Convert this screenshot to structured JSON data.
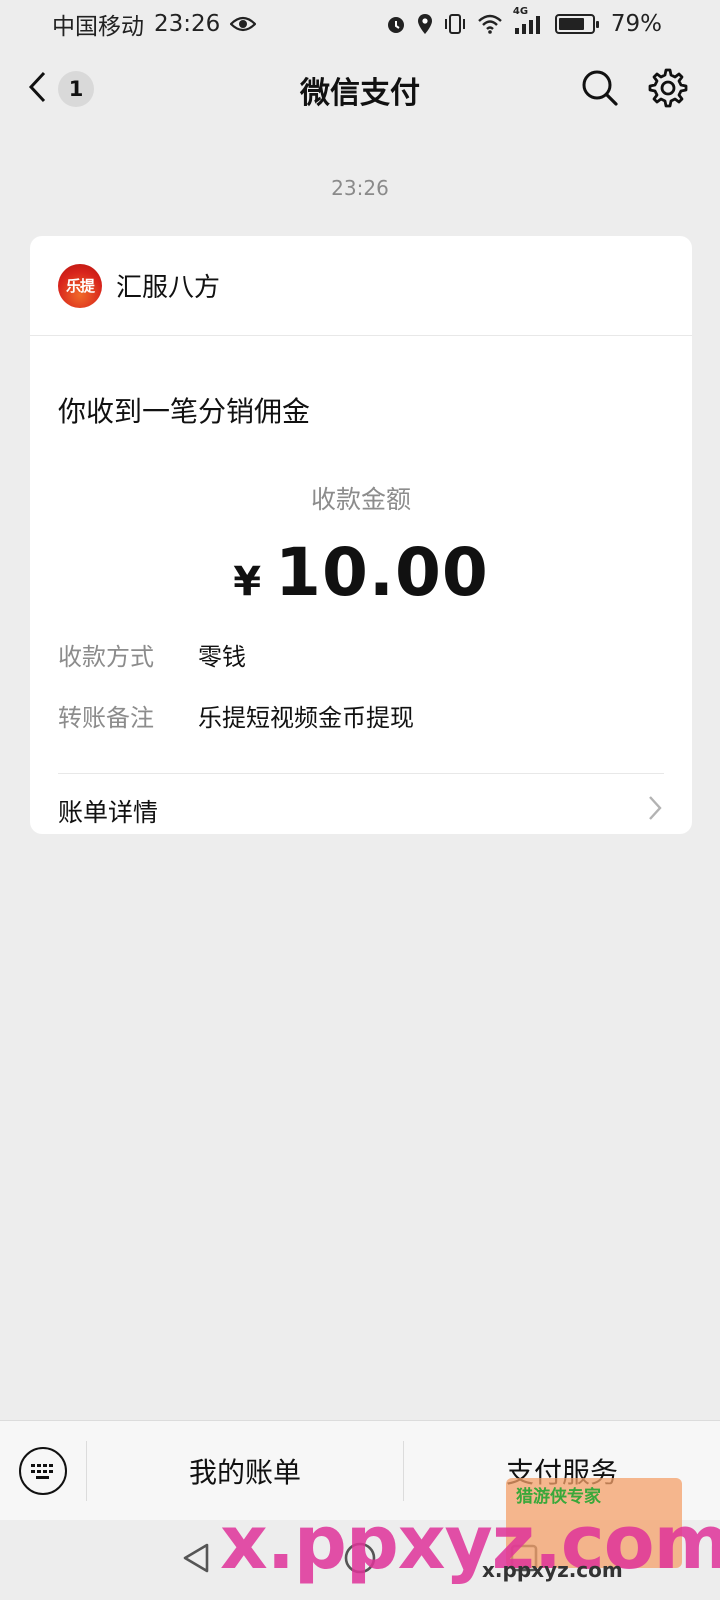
{
  "status_bar": {
    "carrier": "中国移动",
    "time": "23:26",
    "network": "4G",
    "battery": "79%",
    "battery_level": 0.79
  },
  "nav": {
    "back_badge": "1",
    "title": "微信支付"
  },
  "message": {
    "timestamp": "23:26",
    "merchant": {
      "logo_text": "乐提",
      "name": "汇服八方"
    },
    "title": "你收到一笔分销佣金",
    "amount_label": "收款金额",
    "currency": "¥",
    "amount": "10.00",
    "details": [
      {
        "label": "收款方式",
        "value": "零钱"
      },
      {
        "label": "转账备注",
        "value": "乐提短视频金币提现"
      }
    ],
    "bill_link": "账单详情"
  },
  "bottom_bar": {
    "items": [
      "我的账单",
      "支付服务"
    ]
  },
  "watermark": {
    "text": "x.ppxyz.com",
    "badge": "猎游侠专家",
    "url": "x.ppxyz.com"
  }
}
